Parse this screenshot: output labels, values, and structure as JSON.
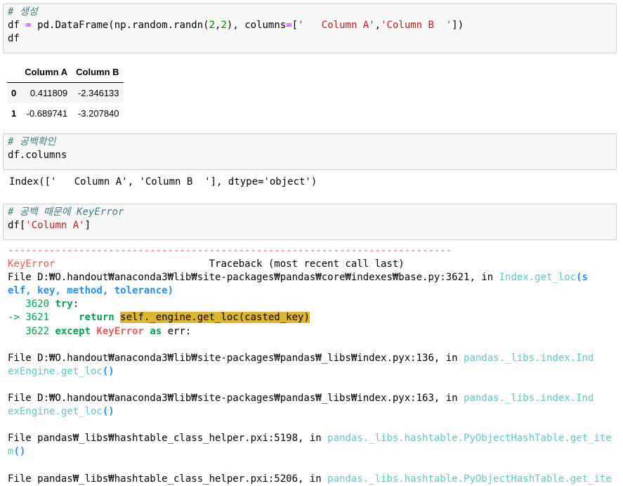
{
  "cell1": {
    "comment": "# 생성",
    "line2_prefix": "df ",
    "line2_eq": "=",
    "line2_call": " pd.DataFrame(np.random.randn(",
    "line2_n1": "2",
    "line2_comma": ",",
    "line2_n2": "2",
    "line2_cols": "), columns",
    "line2_eq2": "=",
    "line2_bracket": "[",
    "line2_str1": "'   Column A'",
    "line2_sep": ",",
    "line2_str2": "'Column B  '",
    "line2_close": "])",
    "line3": "df"
  },
  "dataframe": {
    "columns": [
      "Column A",
      "Column B"
    ],
    "rows": [
      {
        "index": "0",
        "a": "0.411809",
        "b": "-2.346133"
      },
      {
        "index": "1",
        "a": "-0.689741",
        "b": "-3.207840"
      }
    ]
  },
  "cell2": {
    "comment": "# 공백확인",
    "line2": "df.columns"
  },
  "output2": "Index(['   Column A', 'Column B  '], dtype='object')",
  "cell3": {
    "comment": "# 공백 때문에 KeyError",
    "line2_prefix": "df[",
    "line2_str": "'Column A'",
    "line2_close": "]"
  },
  "traceback": {
    "dashes": "---------------------------------------------------------------------------",
    "error_name": "KeyError",
    "header_right": "                          Traceback (most recent call last)",
    "frame1_file": "File D:₩O.handout₩anaconda3₩lib₩site-packages₩pandas₩core₩indexes₩base.py:3621, in ",
    "frame1_func": "Index.get_loc",
    "frame1_paren": "(s",
    "frame1_args": "elf, key, method, tolerance)",
    "l3620_num": "   3620 ",
    "l3620_kw": "try",
    "l3620_rest": ":",
    "l3621_arrow": "-> 3621 ",
    "l3621_kw": "    return ",
    "l3621_hl": "self._engine.get_loc(casted_key)",
    "l3622_num": "   3622 ",
    "l3622_kw": "except ",
    "l3622_err": "KeyError ",
    "l3622_as": "as",
    "l3622_rest": " err:",
    "frame2_file": "File D:₩O.handout₩anaconda3₩lib₩site-packages₩pandas₩_libs₩index.pyx:136, in ",
    "frame2_func_a": "pandas._libs.index.Ind",
    "frame2_func_b": "exEngine.get_loc",
    "frame2_paren": "()",
    "frame3_file": "File D:₩O.handout₩anaconda3₩lib₩site-packages₩pandas₩_libs₩index.pyx:163, in ",
    "frame3_func_a": "pandas._libs.index.Ind",
    "frame3_func_b": "exEngine.get_loc",
    "frame3_paren": "()",
    "frame4_file": "File pandas₩_libs₩hashtable_class_helper.pxi:5198, in ",
    "frame4_func_a": "pandas._libs.hashtable.PyObjectHashTable.get_ite",
    "frame4_func_b": "m",
    "frame4_paren": "()",
    "frame5_file": "File pandas₩_libs₩hashtable_class_helper.pxi:5206, in ",
    "frame5_func_a": "pandas._libs.hashtable.PyObjectHashTable.get_ite"
  },
  "colors": {
    "comment": "#408080",
    "string": "#ba2121",
    "operator": "#aa22ff",
    "number": "#008000",
    "error_red": "#e75c58",
    "line_green": "#00a250",
    "func_cyan": "#60c6c8",
    "paren_blue": "#208ffb",
    "highlight": "#ddb62b",
    "cell_bg": "#f7f7f7"
  }
}
